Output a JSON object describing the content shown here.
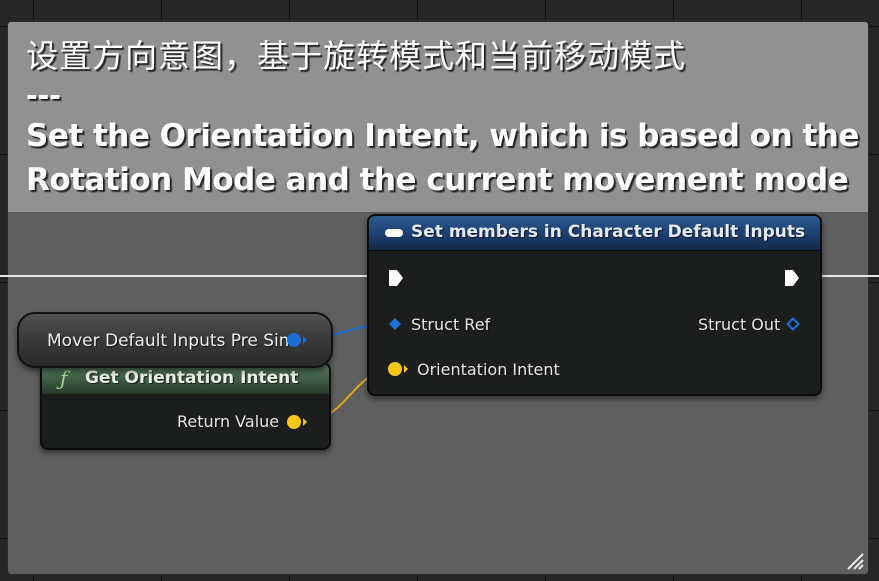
{
  "comment": {
    "line_chinese": "设置方向意图，基于旋转模式和当前移动模式",
    "line_separator": "---",
    "line_english_1": "Set the Orientation Intent, which is based on the",
    "line_english_2": "Rotation Mode and the current movement mode"
  },
  "set_node": {
    "title": "Set members in Character Default Inputs",
    "input_struct_label": "Struct Ref",
    "input_orientation_label": "Orientation Intent",
    "output_struct_label": "Struct Out",
    "icon": "struct-icon"
  },
  "get_node": {
    "title": "Get Orientation Intent",
    "output_label": "Return Value",
    "icon": "function-icon",
    "icon_glyph": "ƒ"
  },
  "var_node": {
    "label": "Mover Default Inputs Pre Sim"
  },
  "colors": {
    "struct_pin": "#1a6fd6",
    "vector_pin": "#f5c518",
    "exec_pin": "#ffffff",
    "set_header": "#1b3f70",
    "function_header": "#3c5a42",
    "comment_header": "#919191",
    "comment_body": "#5f5f5f"
  }
}
